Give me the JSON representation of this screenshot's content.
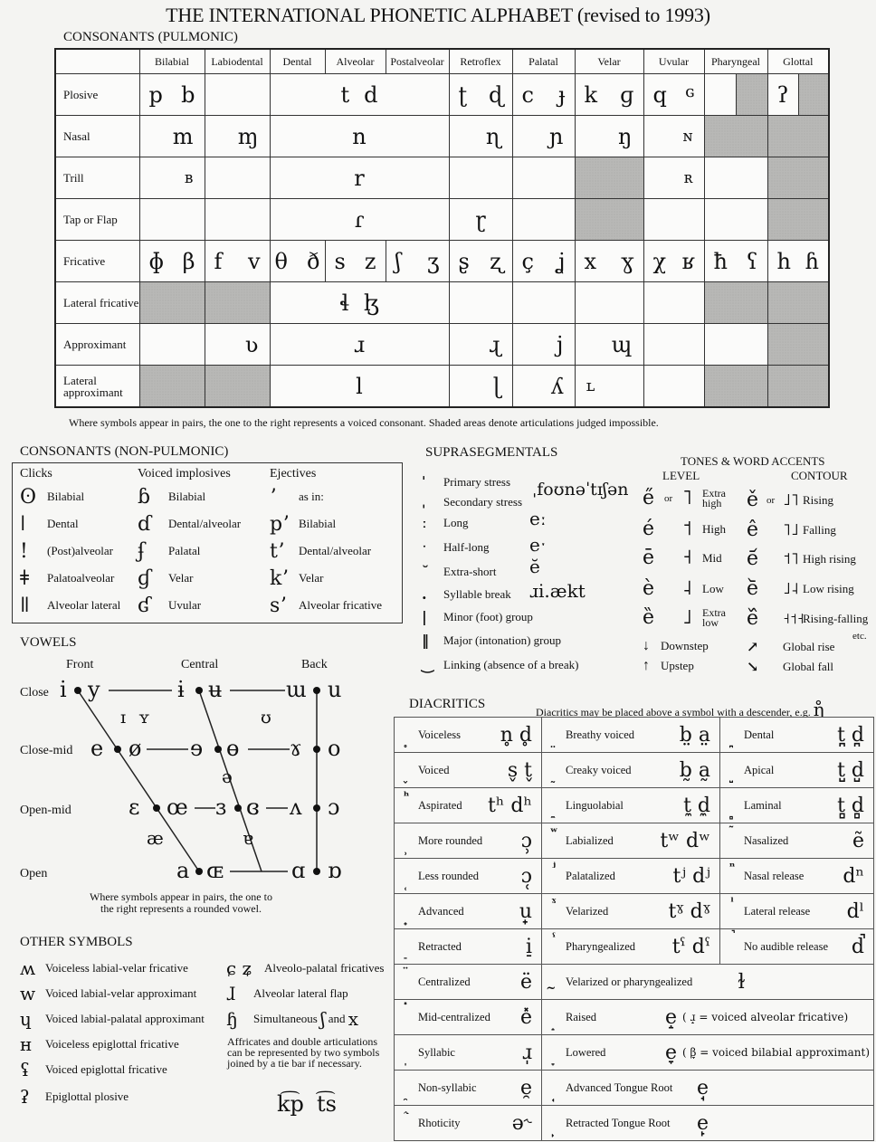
{
  "title": "THE INTERNATIONAL PHONETIC ALPHABET (revised to 1993)",
  "pulmonic": {
    "heading": "CONSONANTS (PULMONIC)",
    "columns": [
      "Bilabial",
      "Labiodental",
      "Dental",
      "Alveolar",
      "Postalveolar",
      "Retroflex",
      "Palatal",
      "Velar",
      "Uvular",
      "Pharyngeal",
      "Glottal"
    ],
    "rows": {
      "plosive": {
        "label": "Plosive",
        "bilabial": [
          "p",
          "b"
        ],
        "alveolar": [
          "t",
          "d"
        ],
        "retroflex": [
          "ʈ",
          "ɖ"
        ],
        "palatal": [
          "c",
          "ɟ"
        ],
        "velar": [
          "k",
          "ɡ"
        ],
        "uvular": [
          "q",
          "ɢ"
        ],
        "glottal": "ʔ"
      },
      "nasal": {
        "label": "Nasal",
        "bilabial": "m",
        "labiodental": "ɱ",
        "alveolar": "n",
        "retroflex": "ɳ",
        "palatal": "ɲ",
        "velar": "ŋ",
        "uvular": "ɴ"
      },
      "trill": {
        "label": "Trill",
        "bilabial": "ʙ",
        "alveolar": "r",
        "uvular": "ʀ"
      },
      "tap": {
        "label": "Tap or Flap",
        "alveolar": "ɾ",
        "retroflex": "ɽ"
      },
      "fricative": {
        "label": "Fricative",
        "bilabial": [
          "ɸ",
          "β"
        ],
        "labiodental": [
          "f",
          "v"
        ],
        "dental": [
          "θ",
          "ð"
        ],
        "alveolar": [
          "s",
          "z"
        ],
        "postalveolar": [
          "ʃ",
          "ʒ"
        ],
        "retroflex": [
          "ʂ",
          "ʐ"
        ],
        "palatal": [
          "ç",
          "ʝ"
        ],
        "velar": [
          "x",
          "ɣ"
        ],
        "uvular": [
          "χ",
          "ʁ"
        ],
        "pharyngeal": [
          "ħ",
          "ʕ"
        ],
        "glottal": [
          "h",
          "ɦ"
        ]
      },
      "latfric": {
        "label": "Lateral fricative",
        "alveolar": [
          "ɬ",
          "ɮ"
        ]
      },
      "approx": {
        "label": "Approximant",
        "labiodental": "ʋ",
        "alveolar": "ɹ",
        "retroflex": "ɻ",
        "palatal": "j",
        "velar": "ɰ"
      },
      "latapprox": {
        "label": "Lateral approximant",
        "alveolar": "l",
        "retroflex": "ɭ",
        "palatal": "ʎ",
        "velar": "ʟ"
      }
    },
    "note": "Where symbols appear in pairs, the one to the right represents a voiced consonant. Shaded areas denote articulations judged impossible."
  },
  "nonpulmonic": {
    "heading": "CONSONANTS (NON-PULMONIC)",
    "clicks": {
      "heading": "Clicks",
      "items": [
        {
          "sym": "ʘ",
          "label": "Bilabial"
        },
        {
          "sym": "ǀ",
          "label": "Dental"
        },
        {
          "sym": "!",
          "label": "(Post)alveolar"
        },
        {
          "sym": "ǂ",
          "label": "Palatoalveolar"
        },
        {
          "sym": "ǁ",
          "label": "Alveolar lateral"
        }
      ]
    },
    "implosives": {
      "heading": "Voiced implosives",
      "items": [
        {
          "sym": "ɓ",
          "label": "Bilabial"
        },
        {
          "sym": "ɗ",
          "label": "Dental/alveolar"
        },
        {
          "sym": "ʄ",
          "label": "Palatal"
        },
        {
          "sym": "ɠ",
          "label": "Velar"
        },
        {
          "sym": "ʛ",
          "label": "Uvular"
        }
      ]
    },
    "ejectives": {
      "heading": "Ejectives",
      "items": [
        {
          "sym": "ʼ",
          "label": "as in:"
        },
        {
          "sym": "pʼ",
          "label": "Bilabial"
        },
        {
          "sym": "tʼ",
          "label": "Dental/alveolar"
        },
        {
          "sym": "kʼ",
          "label": "Velar"
        },
        {
          "sym": "sʼ",
          "label": "Alveolar fricative"
        }
      ]
    }
  },
  "supra": {
    "heading": "SUPRASEGMENTALS",
    "items": [
      {
        "mark": "ˈ",
        "label": "Primary stress"
      },
      {
        "mark": "ˌ",
        "label": "Secondary stress"
      },
      {
        "mark": "ː",
        "label": "Long"
      },
      {
        "mark": "ˑ",
        "label": "Half-long"
      },
      {
        "mark": "˘",
        "label": "Extra-short"
      },
      {
        "mark": ".",
        "label": "Syllable break"
      },
      {
        "mark": "|",
        "label": "Minor (foot) group"
      },
      {
        "mark": "‖",
        "label": "Major (intonation) group"
      },
      {
        "mark": "‿",
        "label": "Linking (absence of a break)"
      }
    ],
    "examples": {
      "stress": "ˌfoʊnəˈtɪʃən",
      "long": "eː",
      "halflong": "eˑ",
      "extrashort": "ĕ",
      "syllable": "ɹi.ækt"
    }
  },
  "tones": {
    "heading": "TONES & WORD ACCENTS",
    "level_heading": "LEVEL",
    "contour_heading": "CONTOUR",
    "or": "or",
    "level": [
      {
        "sym": "e̋",
        "letter": "˥",
        "label": "Extra high"
      },
      {
        "sym": "é",
        "letter": "˦",
        "label": "High"
      },
      {
        "sym": "ē",
        "letter": "˧",
        "label": "Mid"
      },
      {
        "sym": "è",
        "letter": "˨",
        "label": "Low"
      },
      {
        "sym": "ȅ",
        "letter": "˩",
        "label": "Extra low"
      }
    ],
    "contour": [
      {
        "sym": "ě",
        "letter": "˩˥",
        "label": "Rising"
      },
      {
        "sym": "ê",
        "letter": "˥˩",
        "label": "Falling"
      },
      {
        "sym": "e᷄",
        "letter": "˦˥",
        "label": "High rising"
      },
      {
        "sym": "e᷅",
        "letter": "˩˨",
        "label": "Low rising"
      },
      {
        "sym": "e᷈",
        "letter": "˧˦˧",
        "label": "Rising-falling"
      }
    ],
    "etc": "etc.",
    "downstep": {
      "sym": "↓",
      "label": "Downstep"
    },
    "upstep": {
      "sym": "↑",
      "label": "Upstep"
    },
    "globalrise": {
      "sym": "↗",
      "label": "Global rise"
    },
    "globalfall": {
      "sym": "↘",
      "label": "Global fall"
    }
  },
  "vowels": {
    "heading": "VOWELS",
    "cols": {
      "front": "Front",
      "central": "Central",
      "back": "Back"
    },
    "rows": {
      "close": "Close",
      "closemid": "Close-mid",
      "openmid": "Open-mid",
      "open": "Open"
    },
    "symbols": {
      "i": "i",
      "y": "y",
      "ɨ": "ɨ",
      "ʉ": "ʉ",
      "ɯ": "ɯ",
      "u": "u",
      "ɪ": "ɪ",
      "ʏ": "ʏ",
      "ʊ": "ʊ",
      "e": "e",
      "ø": "ø",
      "ɘ": "ɘ",
      "ɵ": "ɵ",
      "ɤ": "ɤ",
      "o": "o",
      "ə": "ə",
      "ɛ": "ɛ",
      "œ": "œ",
      "ɜ": "ɜ",
      "ɞ": "ɞ",
      "ʌ": "ʌ",
      "ɔ": "ɔ",
      "æ": "æ",
      "ɐ": "ɐ",
      "a": "a",
      "ɶ": "ɶ",
      "ɑ": "ɑ",
      "ɒ": "ɒ"
    },
    "note": "Where symbols appear in pairs, the one to the right represents a rounded vowel."
  },
  "other": {
    "heading": "OTHER SYMBOLS",
    "left": [
      {
        "sym": "ʍ",
        "label": "Voiceless labial-velar fricative"
      },
      {
        "sym": "w",
        "label": "Voiced labial-velar approximant"
      },
      {
        "sym": "ɥ",
        "label": "Voiced labial-palatal approximant"
      },
      {
        "sym": "ʜ",
        "label": "Voiceless epiglottal fricative"
      },
      {
        "sym": "ʢ",
        "label": "Voiced epiglottal fricative"
      },
      {
        "sym": "ʡ",
        "label": "Epiglottal plosive"
      }
    ],
    "right": [
      {
        "sym": "ɕ ʑ",
        "label": "Alveolo-palatal fricatives"
      },
      {
        "sym": "ɺ",
        "label": "Alveolar lateral flap"
      },
      {
        "sym": "ɧ",
        "label": "Simultaneous",
        "sym2": "ʃ",
        "and": "and",
        "sym3": "x"
      }
    ],
    "affricate_note": "Affricates and double articulations can be represented by two symbols joined by a tie bar if necessary.",
    "tiebar_examples": [
      "k͡p",
      "t͡s"
    ]
  },
  "diacritics": {
    "heading": "DIACRITICS",
    "note": "Diacritics may be placed above a symbol with a descender, e.g.",
    "note_example": "ŋ̊",
    "rows": [
      [
        {
          "mark": "̥",
          "label": "Voiceless",
          "ex": "n̥  d̥"
        },
        {
          "mark": "̤",
          "label": "Breathy voiced",
          "ex": "b̤  a̤"
        },
        {
          "mark": "̪",
          "label": "Dental",
          "ex": "t̪  d̪"
        }
      ],
      [
        {
          "mark": "̬",
          "label": "Voiced",
          "ex": "s̬  t̬"
        },
        {
          "mark": "̰",
          "label": "Creaky voiced",
          "ex": "b̰  a̰"
        },
        {
          "mark": "̺",
          "label": "Apical",
          "ex": "t̺  d̺"
        }
      ],
      [
        {
          "mark": "ʰ",
          "label": "Aspirated",
          "ex": "tʰ  dʰ"
        },
        {
          "mark": "̼",
          "label": "Linguolabial",
          "ex": "t̼  d̼"
        },
        {
          "mark": "̻",
          "label": "Laminal",
          "ex": "t̻  d̻"
        }
      ],
      [
        {
          "mark": "̹",
          "label": "More rounded",
          "ex": "ɔ̹"
        },
        {
          "mark": "ʷ",
          "label": "Labialized",
          "ex": "tʷ dʷ"
        },
        {
          "mark": "̃",
          "label": "Nasalized",
          "ex": "ẽ"
        }
      ],
      [
        {
          "mark": "̜",
          "label": "Less rounded",
          "ex": "ɔ̜"
        },
        {
          "mark": "ʲ",
          "label": "Palatalized",
          "ex": "tʲ  dʲ"
        },
        {
          "mark": "ⁿ",
          "label": "Nasal release",
          "ex": "dⁿ"
        }
      ],
      [
        {
          "mark": "̟",
          "label": "Advanced",
          "ex": "u̟"
        },
        {
          "mark": "ˠ",
          "label": "Velarized",
          "ex": "tˠ dˠ"
        },
        {
          "mark": "ˡ",
          "label": "Lateral release",
          "ex": "dˡ"
        }
      ],
      [
        {
          "mark": "̠",
          "label": "Retracted",
          "ex": "i̠"
        },
        {
          "mark": "ˤ",
          "label": "Pharyngealized",
          "ex": "tˤ dˤ"
        },
        {
          "mark": "̚",
          "label": "No audible release",
          "ex": "d̚"
        }
      ],
      [
        {
          "mark": "̈",
          "label": "Centralized",
          "ex": "ë"
        },
        {
          "mark": "̴",
          "label": "Velarized or pharyngealized",
          "ex": "ɫ"
        }
      ],
      [
        {
          "mark": "̽",
          "label": "Mid-centralized",
          "ex": "e̽"
        },
        {
          "mark": "̝",
          "label": "Raised",
          "ex": "e̝",
          "paren": "( ɹ̝  = voiced alveolar fricative)"
        }
      ],
      [
        {
          "mark": "̩",
          "label": "Syllabic",
          "ex": "ɹ̩"
        },
        {
          "mark": "̞",
          "label": "Lowered",
          "ex": "e̞",
          "paren": "( β̞  = voiced bilabial approximant)"
        }
      ],
      [
        {
          "mark": "̯",
          "label": "Non-syllabic",
          "ex": "e̯"
        },
        {
          "mark": "̘",
          "label": "Advanced Tongue Root",
          "ex": "e̘"
        }
      ],
      [
        {
          "mark": "˞",
          "label": "Rhoticity",
          "ex": "ə˞"
        },
        {
          "mark": "̙",
          "label": "Retracted Tongue Root",
          "ex": "e̙"
        }
      ]
    ]
  }
}
